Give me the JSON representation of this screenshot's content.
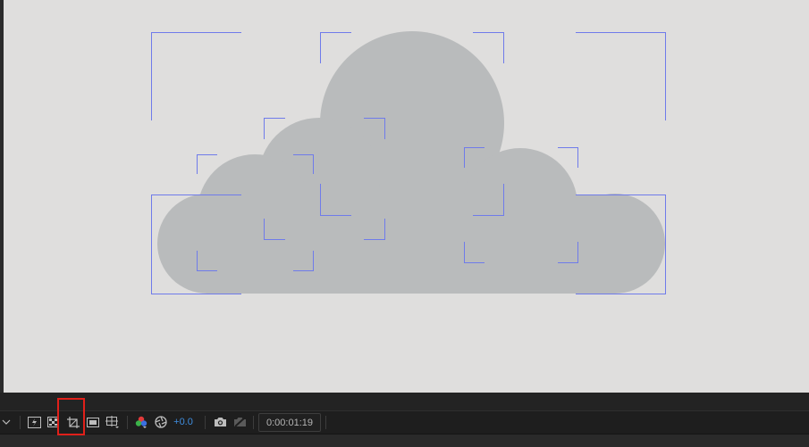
{
  "toolbar": {
    "exposure_value": "+0.0",
    "timecode": "0:00:01:19",
    "highlighted_tool": "region-of-interest-icon"
  },
  "colors": {
    "canvas_bg": "#dfdedd",
    "cloud_fill": "#b9bbbc",
    "bounding_box": "#6f7bea",
    "highlight": "#e0201a",
    "exposure_text": "#3f8ee0"
  },
  "icons": [
    "chevron-down-icon",
    "fast-previews-icon",
    "transparency-grid-icon",
    "region-of-interest-icon",
    "toggle-mask-visibility-icon",
    "choose-grid-guide-icon",
    "channel-rgb-icon",
    "reset-exposure-icon",
    "snapshot-camera-icon",
    "show-snapshot-icon"
  ]
}
